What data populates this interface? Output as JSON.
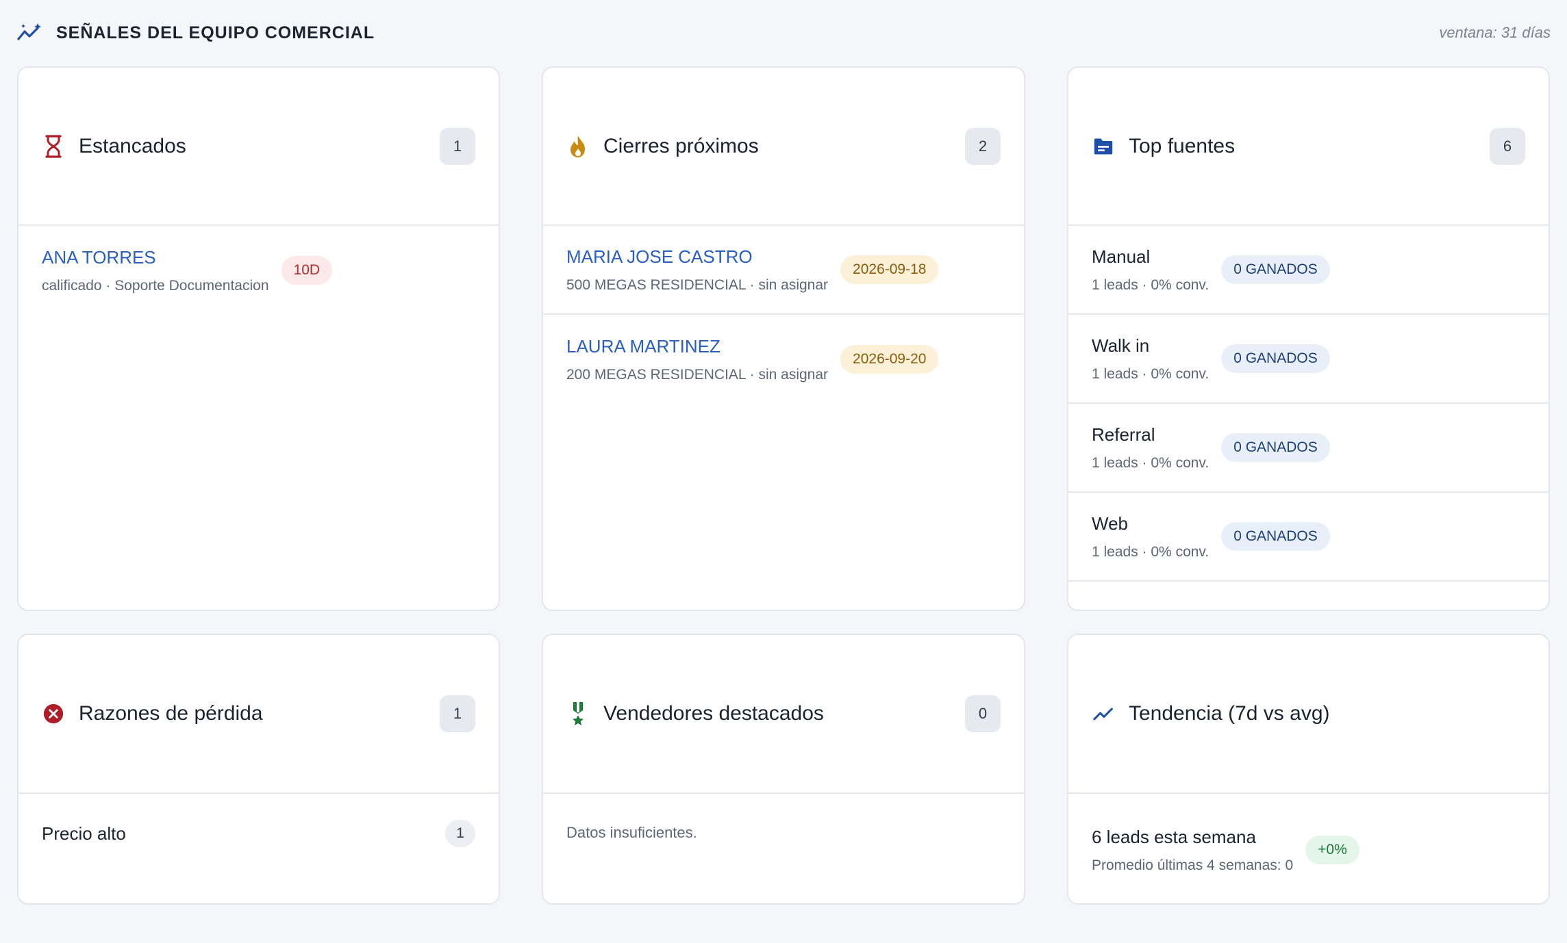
{
  "header": {
    "title": "SEÑALES DEL EQUIPO COMERCIAL",
    "window_label": "ventana: 31 días"
  },
  "colors": {
    "link": "#2a5fc0",
    "red_badge_bg": "#fde8ea",
    "amber_badge_bg": "#fcf1d8",
    "blue_badge_bg": "#e8eff9",
    "green_badge_bg": "#e4f5ea"
  },
  "stalled": {
    "title": "Estancados",
    "count": "1",
    "icon": "hourglass-icon",
    "items": [
      {
        "name": "ANA TORRES",
        "meta": "calificado · Soporte Documentacion",
        "badge": "10D"
      }
    ]
  },
  "closing": {
    "title": "Cierres próximos",
    "count": "2",
    "icon": "fire-icon",
    "items": [
      {
        "name": "MARIA JOSE CASTRO",
        "meta": "500 MEGAS RESIDENCIAL · sin asignar",
        "date": "2026-09-18"
      },
      {
        "name": "LAURA MARTINEZ",
        "meta": "200 MEGAS RESIDENCIAL · sin asignar",
        "date": "2026-09-20"
      }
    ]
  },
  "sources": {
    "title": "Top fuentes",
    "count": "6",
    "icon": "source-icon",
    "items": [
      {
        "name": "Manual",
        "meta": "1 leads · 0% conv.",
        "badge": "0 GANADOS"
      },
      {
        "name": "Walk in",
        "meta": "1 leads · 0% conv.",
        "badge": "0 GANADOS"
      },
      {
        "name": "Referral",
        "meta": "1 leads · 0% conv.",
        "badge": "0 GANADOS"
      },
      {
        "name": "Web",
        "meta": "1 leads · 0% conv.",
        "badge": "0 GANADOS"
      }
    ]
  },
  "loss": {
    "title": "Razones de pérdida",
    "count": "1",
    "icon": "cancel-circle-icon",
    "items": [
      {
        "label": "Precio alto",
        "count": "1"
      }
    ]
  },
  "sellers": {
    "title": "Vendedores destacados",
    "count": "0",
    "icon": "medal-icon",
    "empty_text": "Datos insuficientes."
  },
  "trend": {
    "title": "Tendencia (7d vs avg)",
    "icon": "trending-up-icon",
    "headline": "6 leads esta semana",
    "sub": "Promedio últimas 4 semanas: 0",
    "delta": "+0%"
  }
}
